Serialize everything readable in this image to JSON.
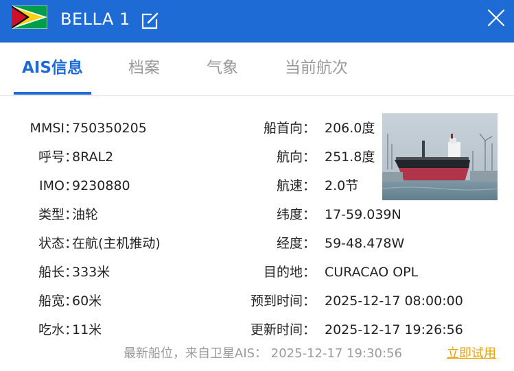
{
  "header": {
    "title": "BELLA 1",
    "flag_icon": "guyana-flag-icon",
    "edit_icon": "edit-icon",
    "close_icon": "close-icon",
    "bar_color": "#1e6bd6"
  },
  "tabs": [
    {
      "label": "AIS信息",
      "active": true
    },
    {
      "label": "档案",
      "active": false
    },
    {
      "label": "气象",
      "active": false
    },
    {
      "label": "当前航次",
      "active": false
    }
  ],
  "left_fields": [
    {
      "label": "MMSI",
      "value": "750350205"
    },
    {
      "label": "呼号",
      "value": "8RAL2"
    },
    {
      "label": "IMO",
      "value": "9230880"
    },
    {
      "label": "类型",
      "value": "油轮"
    },
    {
      "label": "状态",
      "value": "在航(主机推动)"
    },
    {
      "label": "船长",
      "value": "333米"
    },
    {
      "label": "船宽",
      "value": "60米"
    },
    {
      "label": "吃水",
      "value": "11米"
    }
  ],
  "right_fields": [
    {
      "label": "船首向：",
      "value": "206.0度"
    },
    {
      "label": "航向：",
      "value": "251.8度"
    },
    {
      "label": "航速：",
      "value": "2.0节"
    },
    {
      "label": "纬度：",
      "value": "17-59.039N"
    },
    {
      "label": "经度：",
      "value": "59-48.478W"
    },
    {
      "label": "目的地：",
      "value": "CURACAO OPL"
    },
    {
      "label": "预到时间：",
      "value": "2025-12-17 08:00:00"
    },
    {
      "label": "更新时间：",
      "value": "2025-12-17 19:26:56"
    }
  ],
  "footer": {
    "note": "最新船位，来自卫星AIS： 2025-12-17 19:30:56",
    "link": "立即试用",
    "link_color": "#e6a100"
  }
}
